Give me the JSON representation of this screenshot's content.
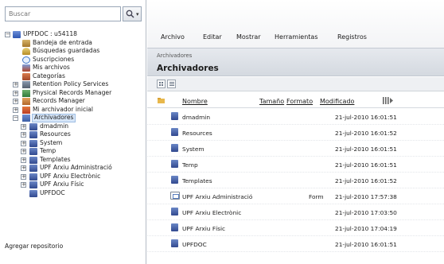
{
  "search": {
    "placeholder": "Buscar"
  },
  "tree": {
    "root_label": "UPFDOC : u54118",
    "items": [
      {
        "label": "Bandeja de entrada",
        "icon": "inbox-icon"
      },
      {
        "label": "Búsquedas guardadas",
        "icon": "saved-search-icon"
      },
      {
        "label": "Suscripciones",
        "icon": "subscription-icon"
      },
      {
        "label": "Mis archivos",
        "icon": "my-files-icon"
      },
      {
        "label": "Categorías",
        "icon": "categories-icon"
      },
      {
        "label": "Retention Policy Services",
        "icon": "retention-icon"
      },
      {
        "label": "Physical Records Manager",
        "icon": "physical-records-icon"
      },
      {
        "label": "Records Manager",
        "icon": "records-manager-icon"
      },
      {
        "label": "Mi archivador inicial",
        "icon": "home-cabinet-icon"
      },
      {
        "label": "Archivadores",
        "icon": "cabinets-icon"
      }
    ],
    "cabinets": [
      "dmadmin",
      "Resources",
      "System",
      "Temp",
      "Templates",
      "UPF Arxiu Administració",
      "UPF Arxiu Electrònic",
      "UPF Arxiu Físic",
      "UPFDOC"
    ],
    "add_repository": "Agregar repositorio"
  },
  "menu": [
    "Archivo",
    "Editar",
    "Mostrar",
    "Herramientas",
    "Registros"
  ],
  "breadcrumb": "Archivadores",
  "page_title": "Archivadores",
  "columns": {
    "name": "Nombre",
    "size": "Tamaño",
    "format": "Formato",
    "modified": "Modificado"
  },
  "rows": [
    {
      "name": "dmadmin",
      "format": "",
      "modified": "21-jul-2010 16:01:51",
      "icon": "cabinet-icon"
    },
    {
      "name": "Resources",
      "format": "",
      "modified": "21-jul-2010 16:01:52",
      "icon": "cabinet-icon"
    },
    {
      "name": "System",
      "format": "",
      "modified": "21-jul-2010 16:01:51",
      "icon": "cabinet-icon"
    },
    {
      "name": "Temp",
      "format": "",
      "modified": "21-jul-2010 16:01:51",
      "icon": "cabinet-icon"
    },
    {
      "name": "Templates",
      "format": "",
      "modified": "21-jul-2010 16:01:52",
      "icon": "cabinet-icon"
    },
    {
      "name": "UPF Arxiu Administració",
      "format": "Form",
      "modified": "21-jul-2010 17:57:38",
      "icon": "form-icon"
    },
    {
      "name": "UPF Arxiu Electrònic",
      "format": "",
      "modified": "21-jul-2010 17:03:50",
      "icon": "cabinet-icon"
    },
    {
      "name": "UPF Arxiu Físic",
      "format": "",
      "modified": "21-jul-2010 17:04:19",
      "icon": "cabinet-icon"
    },
    {
      "name": "UPFDOC",
      "format": "",
      "modified": "21-jul-2010 16:01:51",
      "icon": "cabinet-icon"
    }
  ],
  "colors": {
    "selection": "#d7e6f8",
    "header_band": "#dde1e7",
    "cabinet": "#3b5ea6"
  }
}
